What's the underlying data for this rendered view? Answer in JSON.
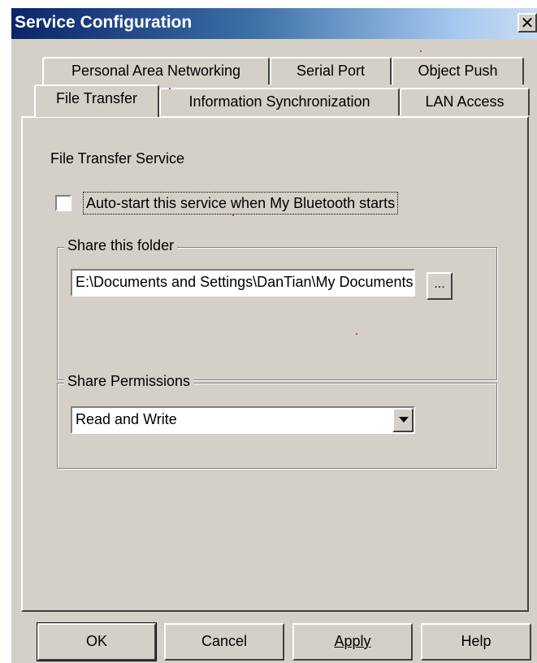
{
  "window": {
    "title": "Service Configuration",
    "close_glyph": "✕"
  },
  "tabs": {
    "row1": [
      "Personal Area Networking",
      "Serial Port",
      "Object Push"
    ],
    "row2": [
      "File Transfer",
      "Information Synchronization",
      "LAN Access"
    ],
    "active": "File Transfer"
  },
  "panel": {
    "heading": "File Transfer Service",
    "autostart_label": "Auto-start this service when My Bluetooth starts",
    "autostart_checked": false,
    "share_folder": {
      "legend": "Share this folder",
      "path_value": "E:\\Documents and Settings\\DanTian\\My Documents",
      "browse_label": "..."
    },
    "share_permissions": {
      "legend": "Share Permissions",
      "selected": "Read and Write"
    }
  },
  "buttons": {
    "ok": "OK",
    "cancel": "Cancel",
    "apply": "Apply",
    "help": "Help"
  }
}
